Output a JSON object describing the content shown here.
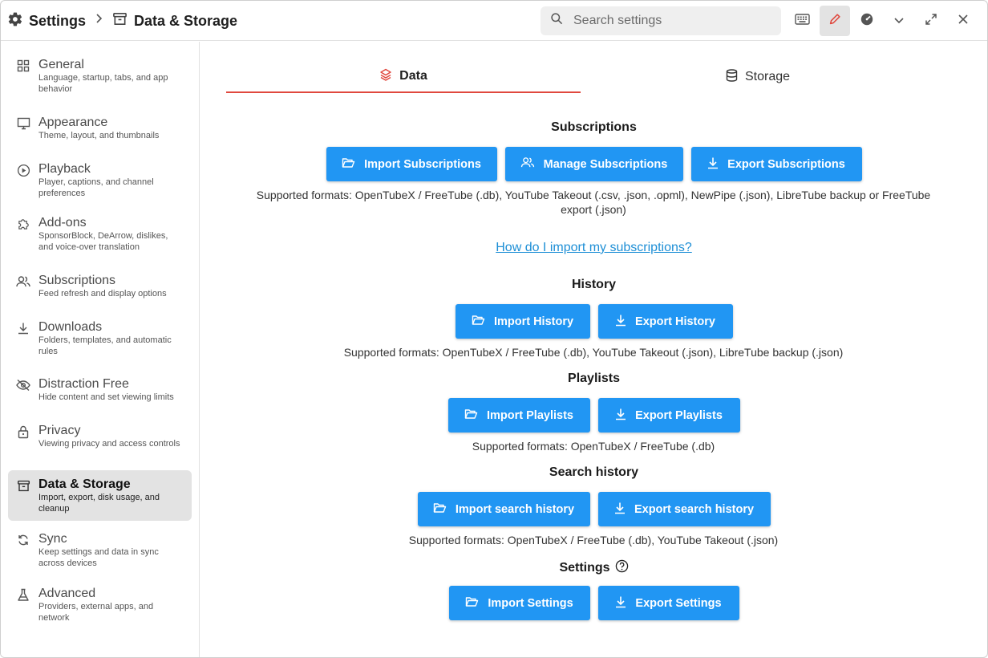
{
  "titlebar": {
    "root_label": "Settings",
    "current_label": "Data & Storage",
    "search_placeholder": "Search settings"
  },
  "sidebar": {
    "items": [
      {
        "label": "General",
        "desc": "Language, startup, tabs, and app behavior",
        "icon": "grid-icon"
      },
      {
        "label": "Appearance",
        "desc": "Theme, layout, and thumbnails",
        "icon": "monitor-icon"
      },
      {
        "label": "Playback",
        "desc": "Player, captions, and channel preferences",
        "icon": "play-circle-icon"
      },
      {
        "label": "Add-ons",
        "desc": "SponsorBlock, DeArrow, dislikes, and voice-over translation",
        "icon": "puzzle-icon"
      },
      {
        "label": "Subscriptions",
        "desc": "Feed refresh and display options",
        "icon": "users-icon"
      },
      {
        "label": "Downloads",
        "desc": "Folders, templates, and automatic rules",
        "icon": "download-icon"
      },
      {
        "label": "Distraction Free",
        "desc": "Hide content and set viewing limits",
        "icon": "eye-off-icon"
      },
      {
        "label": "Privacy",
        "desc": "Viewing privacy and access controls",
        "icon": "lock-icon"
      },
      {
        "label": "Data & Storage",
        "desc": "Import, export, disk usage, and cleanup",
        "icon": "archive-icon",
        "active": true
      },
      {
        "label": "Sync",
        "desc": "Keep settings and data in sync across devices",
        "icon": "sync-icon"
      },
      {
        "label": "Advanced",
        "desc": "Providers, external apps, and network",
        "icon": "flask-icon"
      }
    ]
  },
  "tabs": {
    "data": "Data",
    "storage": "Storage"
  },
  "sections": {
    "subscriptions": {
      "title": "Subscriptions",
      "import": "Import Subscriptions",
      "manage": "Manage Subscriptions",
      "export": "Export Subscriptions",
      "formats": "Supported formats: OpenTubeX / FreeTube (.db), YouTube Takeout (.csv, .json, .opml), NewPipe (.json), LibreTube backup or FreeTube export (.json)",
      "help_link": "How do I import my subscriptions?"
    },
    "history": {
      "title": "History",
      "import": "Import History",
      "export": "Export History",
      "formats": "Supported formats: OpenTubeX / FreeTube (.db), YouTube Takeout (.json), LibreTube backup (.json)"
    },
    "playlists": {
      "title": "Playlists",
      "import": "Import Playlists",
      "export": "Export Playlists",
      "formats": "Supported formats: OpenTubeX / FreeTube (.db)"
    },
    "search_history": {
      "title": "Search history",
      "import": "Import search history",
      "export": "Export search history",
      "formats": "Supported formats: OpenTubeX / FreeTube (.db), YouTube Takeout (.json)"
    },
    "settings": {
      "title": "Settings",
      "import": "Import Settings",
      "export": "Export Settings"
    }
  },
  "colors": {
    "accent_button": "#2196f3",
    "tab_underline": "#e0483e",
    "link": "#1e8fd6",
    "active_nav_bg": "#e3e3e3"
  }
}
